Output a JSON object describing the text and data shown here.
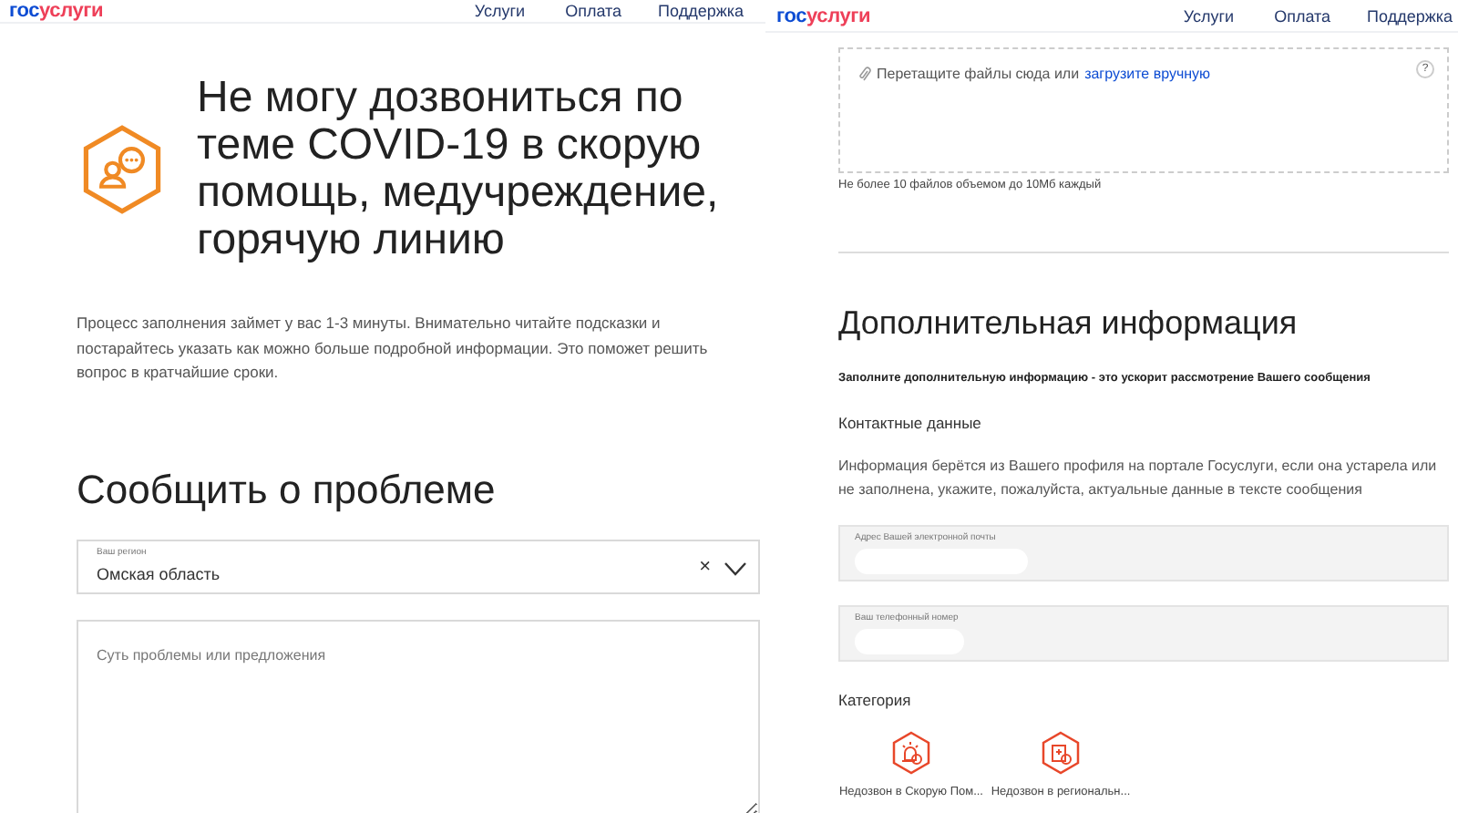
{
  "panes": [
    {
      "header": {
        "logo_a": "гос",
        "logo_b": "услуги",
        "nav": [
          "Услуги",
          "Оплата",
          "Поддержка"
        ]
      },
      "kind": "problem",
      "title": "Не могу дозвониться по теме COVID-19 в скорую помощь, медучреждение, горячую линию",
      "intro": "Процесс заполнения займет у вас 1-3 минуты. Внимательно читайте подсказки и постарайтесь указать как можно больше подробной информации. Это поможет решить вопрос в кратчайшие сроки.",
      "section_title": "Сообщить о проблеме",
      "region": {
        "label": "Ваш регион",
        "value": "Омская область",
        "clear": "×"
      },
      "message": {
        "placeholder": "Суть проблемы или предложения"
      }
    },
    {
      "header": {
        "logo_a": "гос",
        "logo_b": "услуги",
        "nav": [
          "Услуги",
          "Оплата",
          "Поддержка"
        ]
      },
      "kind": "extra",
      "dropzone": {
        "text": "Перетащите файлы сюда или",
        "link": "загрузите вручную",
        "help": "?"
      },
      "limit": "Не более 10 файлов объемом до 10Мб каждый",
      "section_title": "Дополнительная информация",
      "lead": "Заполните дополнительную информацию - это ускорит рассмотрение Вашего сообщения",
      "contacts_title": "Контактные данные",
      "contacts_info": "Информация берётся из Вашего профиля на портале Госуслуги, если она устарела или не заполнена, укажите, пожалуйста, актуальные данные в тексте сообщения",
      "fields": [
        {
          "label": "Адрес Вашей электронной почты"
        },
        {
          "label": "Ваш телефонный номер"
        }
      ],
      "category_title": "Категория",
      "categories": [
        {
          "label": "Недозвон в Скорую Пом...",
          "kind": "alarm"
        },
        {
          "label": "Недозвон в региональн...",
          "kind": "hospital"
        }
      ]
    }
  ]
}
